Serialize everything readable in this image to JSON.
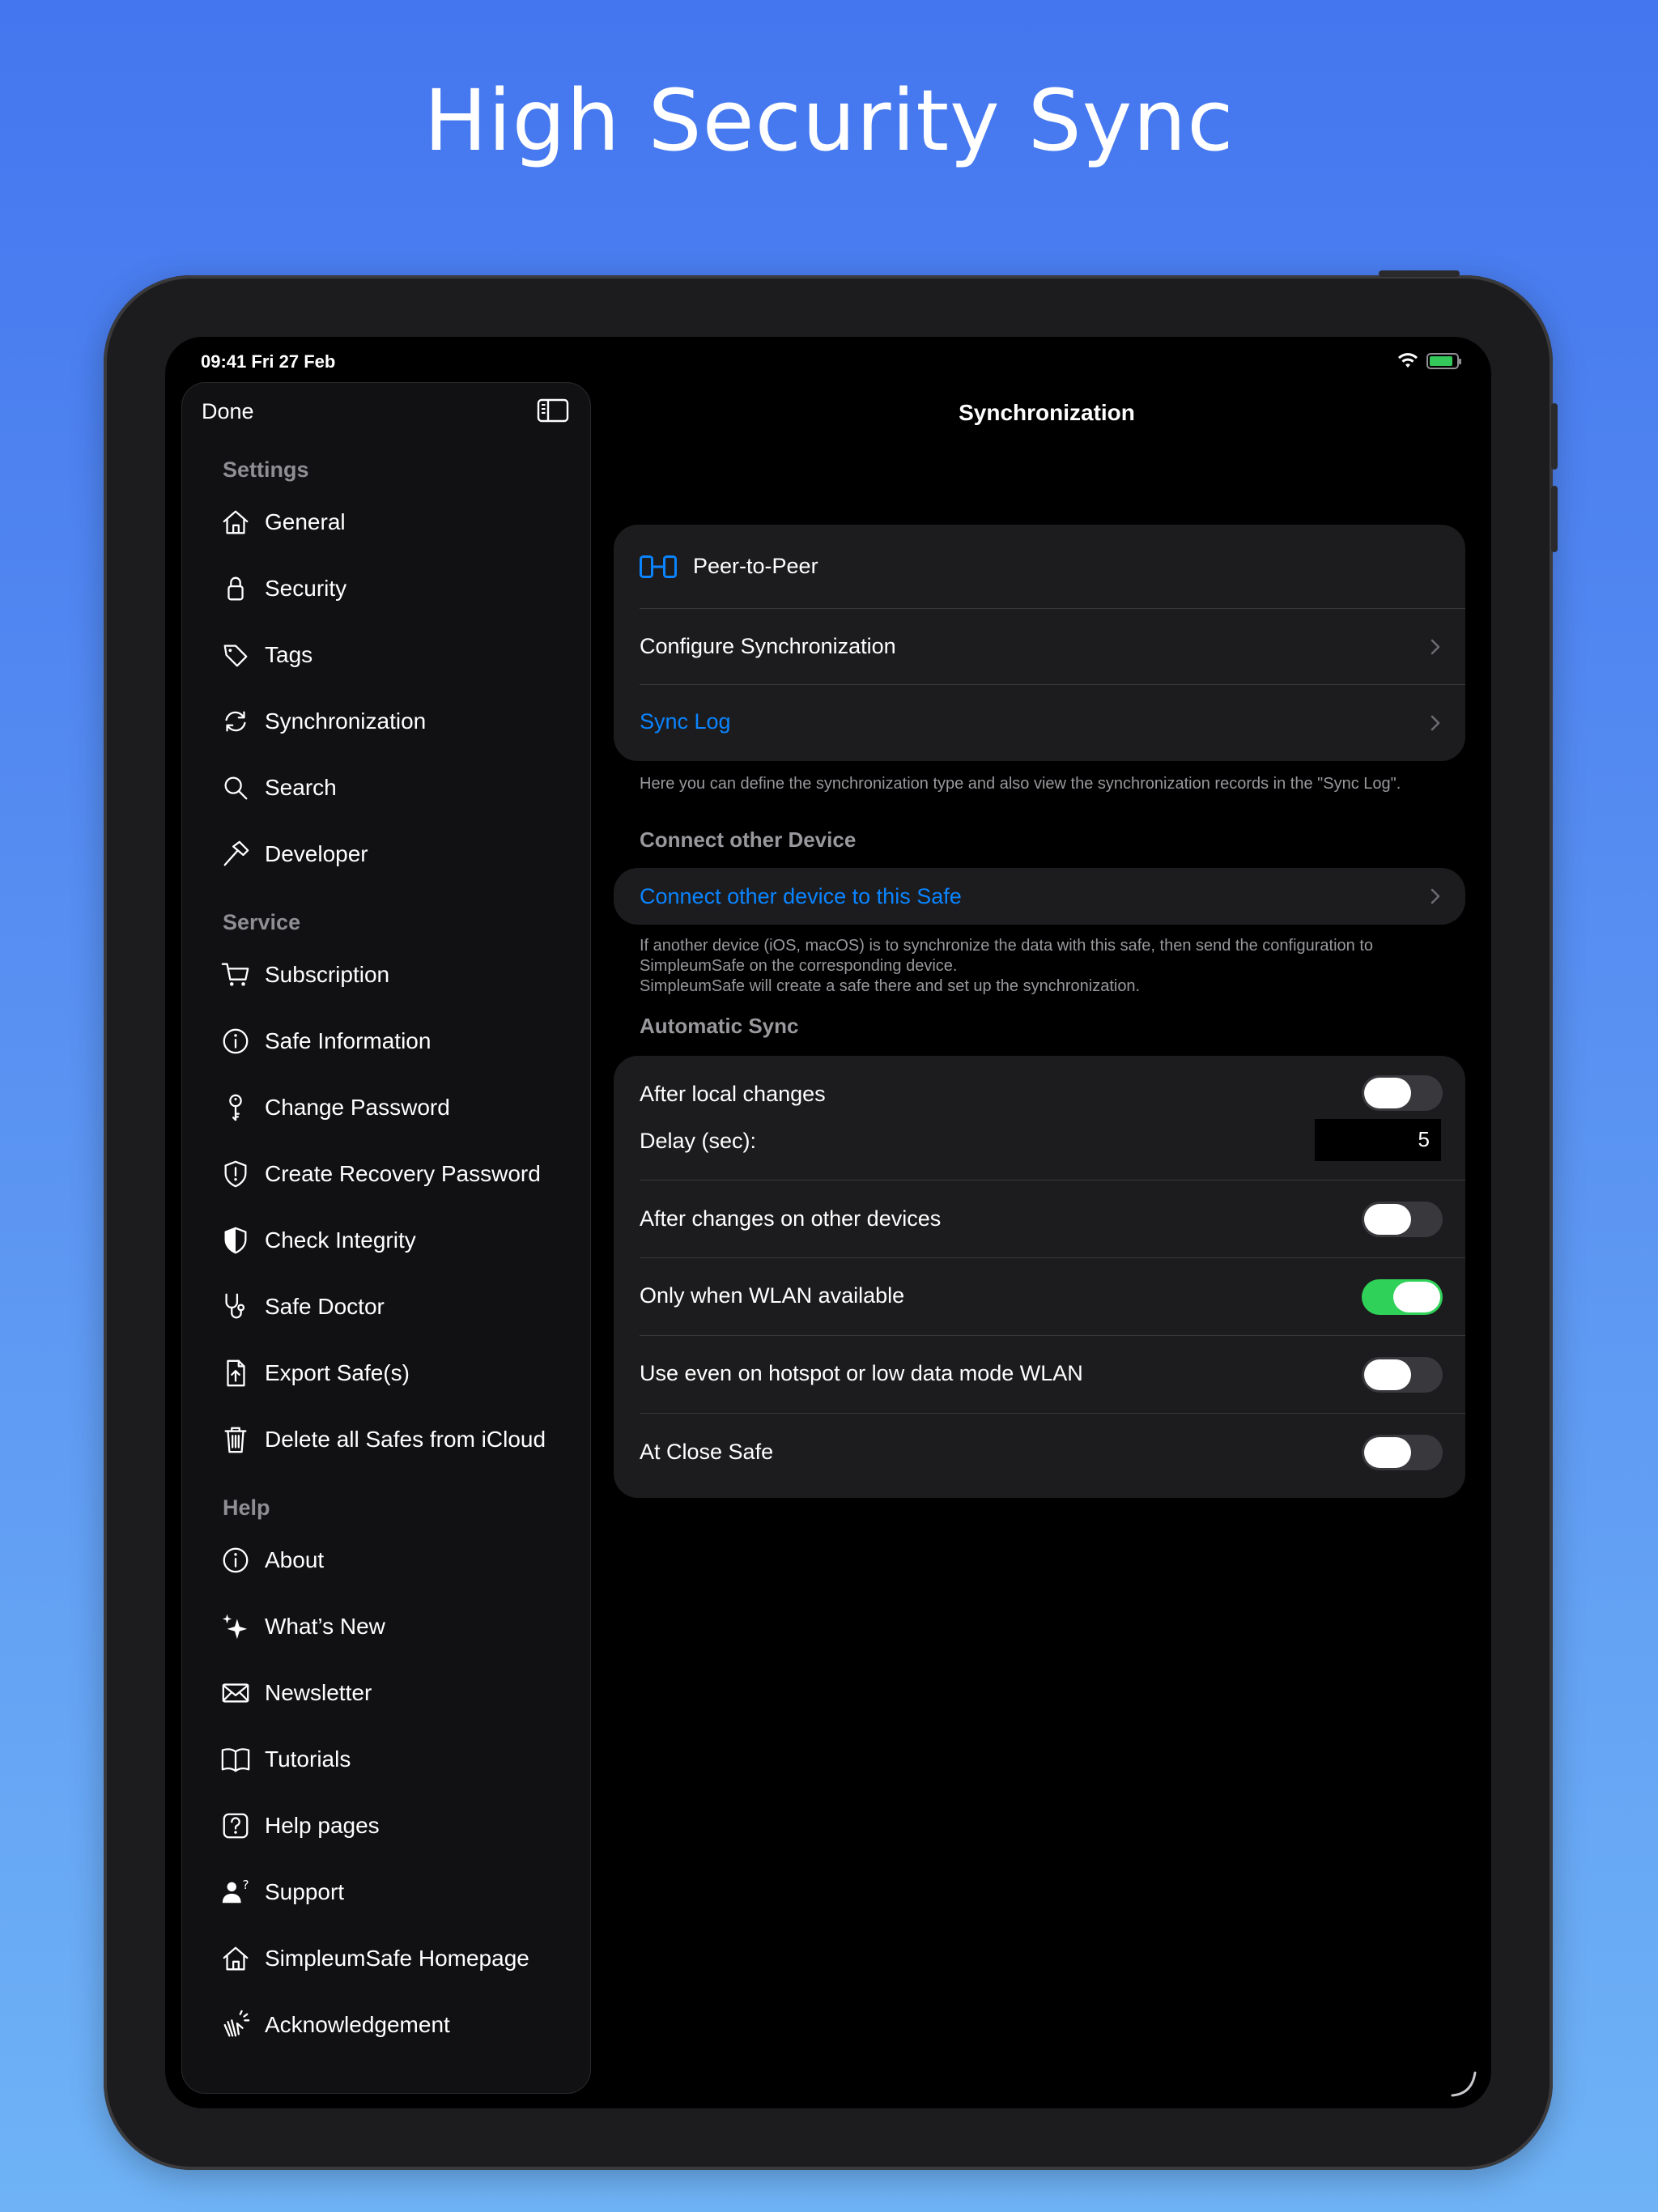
{
  "headline": "High Security Sync",
  "status": {
    "time": "09:41  Fri 27 Feb"
  },
  "sidebar": {
    "done_label": "Done",
    "sections": [
      {
        "title": "Settings",
        "items": [
          {
            "label": "General",
            "icon": "house-icon"
          },
          {
            "label": "Security",
            "icon": "lock-icon"
          },
          {
            "label": "Tags",
            "icon": "tag-icon"
          },
          {
            "label": "Synchronization",
            "icon": "sync-icon"
          },
          {
            "label": "Search",
            "icon": "magnifier-icon"
          },
          {
            "label": "Developer",
            "icon": "hammer-icon"
          }
        ]
      },
      {
        "title": "Service",
        "items": [
          {
            "label": "Subscription",
            "icon": "cart-icon"
          },
          {
            "label": "Safe Information",
            "icon": "info-icon"
          },
          {
            "label": "Change Password",
            "icon": "key-icon"
          },
          {
            "label": "Create Recovery Password",
            "icon": "shield-alert-icon"
          },
          {
            "label": "Check Integrity",
            "icon": "shield-half-icon"
          },
          {
            "label": "Safe Doctor",
            "icon": "stethoscope-icon"
          },
          {
            "label": "Export Safe(s)",
            "icon": "export-doc-icon"
          },
          {
            "label": "Delete all Safes from iCloud",
            "icon": "trash-icon"
          }
        ]
      },
      {
        "title": "Help",
        "items": [
          {
            "label": "About",
            "icon": "info-icon"
          },
          {
            "label": "What’s New",
            "icon": "sparkles-icon"
          },
          {
            "label": "Newsletter",
            "icon": "envelope-icon"
          },
          {
            "label": "Tutorials",
            "icon": "book-icon"
          },
          {
            "label": "Help pages",
            "icon": "question-icon"
          },
          {
            "label": "Support",
            "icon": "person-question-icon"
          },
          {
            "label": "SimpleumSafe Homepage",
            "icon": "house-icon"
          },
          {
            "label": "Acknowledgement",
            "icon": "clapping-hands-icon"
          }
        ]
      }
    ]
  },
  "detail": {
    "title": "Synchronization",
    "sync_group": {
      "mode_label": "Peer-to-Peer",
      "configure_label": "Configure Synchronization",
      "log_label": "Sync Log"
    },
    "sync_footnote": "Here you can define the synchronization type and also view the synchronization records in the \"Sync Log\".",
    "connect_header": "Connect other Device",
    "connect_label": "Connect other device to this Safe",
    "connect_footnote_1": "If another device (iOS, macOS) is to synchronize the data with this safe, then send the configuration to SimpleumSafe on the corresponding device.",
    "connect_footnote_2": "SimpleumSafe will create a safe there and set up the synchronization.",
    "auto_header": "Automatic Sync",
    "auto": {
      "after_local_label": "After local changes",
      "after_local_on": false,
      "delay_label": "Delay (sec):",
      "delay_value": "5",
      "after_other_label": "After changes on other devices",
      "after_other_on": false,
      "wlan_label": "Only when WLAN available",
      "wlan_on": true,
      "hotspot_label": "Use even on hotspot or low data mode WLAN",
      "hotspot_on": false,
      "close_label": "At Close Safe",
      "close_on": false
    }
  },
  "colors": {
    "accent": "#0a84ff",
    "toggle_on": "#30d158",
    "background_top": "#4476ef",
    "background_bottom": "#6fb3f6"
  }
}
